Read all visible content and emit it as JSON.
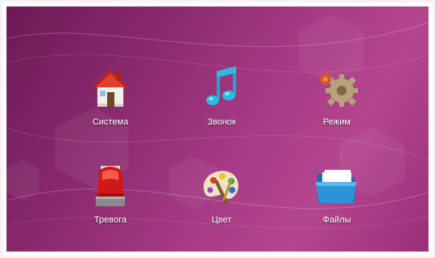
{
  "menu": {
    "items": [
      {
        "label": "Система",
        "icon": "house-icon"
      },
      {
        "label": "Звонок",
        "icon": "music-note-icon"
      },
      {
        "label": "Режим",
        "icon": "gears-icon"
      },
      {
        "label": "Тревога",
        "icon": "alarm-siren-icon"
      },
      {
        "label": "Цвет",
        "icon": "palette-icon"
      },
      {
        "label": "Файлы",
        "icon": "folder-icon"
      }
    ]
  },
  "colors": {
    "background_dark": "#6d1a55",
    "background_light": "#b4468f",
    "label_text": "#ffffff"
  }
}
